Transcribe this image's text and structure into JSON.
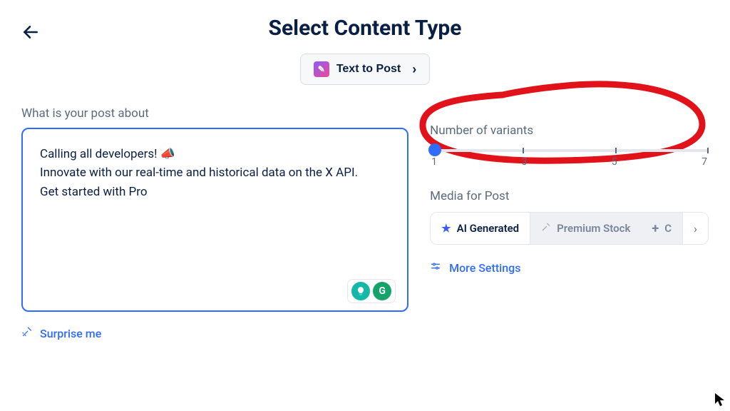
{
  "header": {
    "title": "Select Content Type"
  },
  "content_type_button": {
    "label": "Text to Post"
  },
  "post_about": {
    "label": "What is your post about",
    "value": "Calling all developers! 📣\nInnovate with our real-time and historical data on the X API.\nGet started with Pro"
  },
  "surprise": {
    "label": "Surprise me"
  },
  "variants": {
    "label": "Number of variants",
    "ticks": [
      "1",
      "3",
      "5",
      "7"
    ],
    "value": 1
  },
  "media": {
    "label": "Media for Post",
    "tabs": [
      {
        "label": "AI Generated",
        "active": true
      },
      {
        "label": "Premium Stock",
        "active": false
      },
      {
        "label": "C",
        "active": false
      }
    ]
  },
  "more_settings": {
    "label": "More Settings"
  }
}
